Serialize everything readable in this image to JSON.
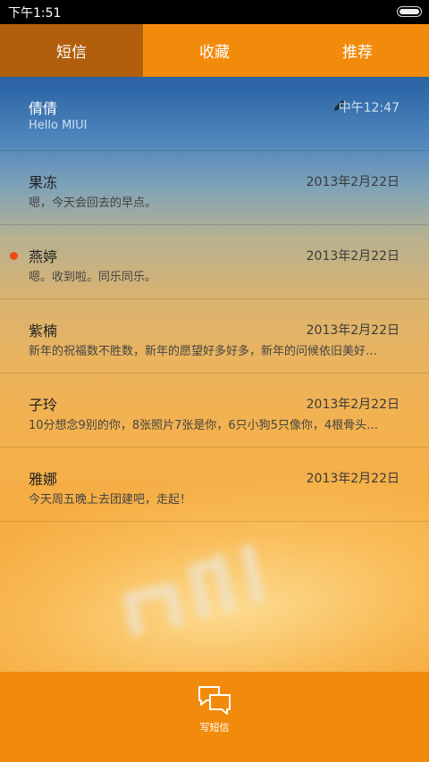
{
  "status_bar": {
    "time": "下午1:51"
  },
  "tabs": [
    {
      "label": "短信",
      "active": true
    },
    {
      "label": "收藏",
      "active": false
    },
    {
      "label": "推荐",
      "active": false
    }
  ],
  "threads": [
    {
      "contact": "倩倩",
      "preview": "Hello MIUI",
      "date": "中午12:47",
      "draft": true,
      "unread": false
    },
    {
      "contact": "果冻",
      "preview": "嗯，今天会回去的早点。",
      "date": "2013年2月22日",
      "draft": false,
      "unread": false
    },
    {
      "contact": "燕婷",
      "preview": "嗯。收到啦。同乐同乐。",
      "date": "2013年2月22日",
      "draft": false,
      "unread": true
    },
    {
      "contact": "紫楠",
      "preview": "新年的祝福数不胜数，新年的愿望好多好多，新年的问候依旧美好…",
      "date": "2013年2月22日",
      "draft": false,
      "unread": false
    },
    {
      "contact": "子玲",
      "preview": "10分想念9别的你，8张照片7张是你，6只小狗5只像你，4根骨头…",
      "date": "2013年2月22日",
      "draft": false,
      "unread": false
    },
    {
      "contact": "雅娜",
      "preview": "今天周五晚上去团建吧，走起！",
      "date": "2013年2月22日",
      "draft": false,
      "unread": false
    }
  ],
  "bottom_bar": {
    "compose_label": "写短信",
    "icon": "compose-chat-icon"
  },
  "colors": {
    "accent": "#f28a0c",
    "tab_active": "#b15f0c",
    "unread_dot": "#f04a12"
  }
}
